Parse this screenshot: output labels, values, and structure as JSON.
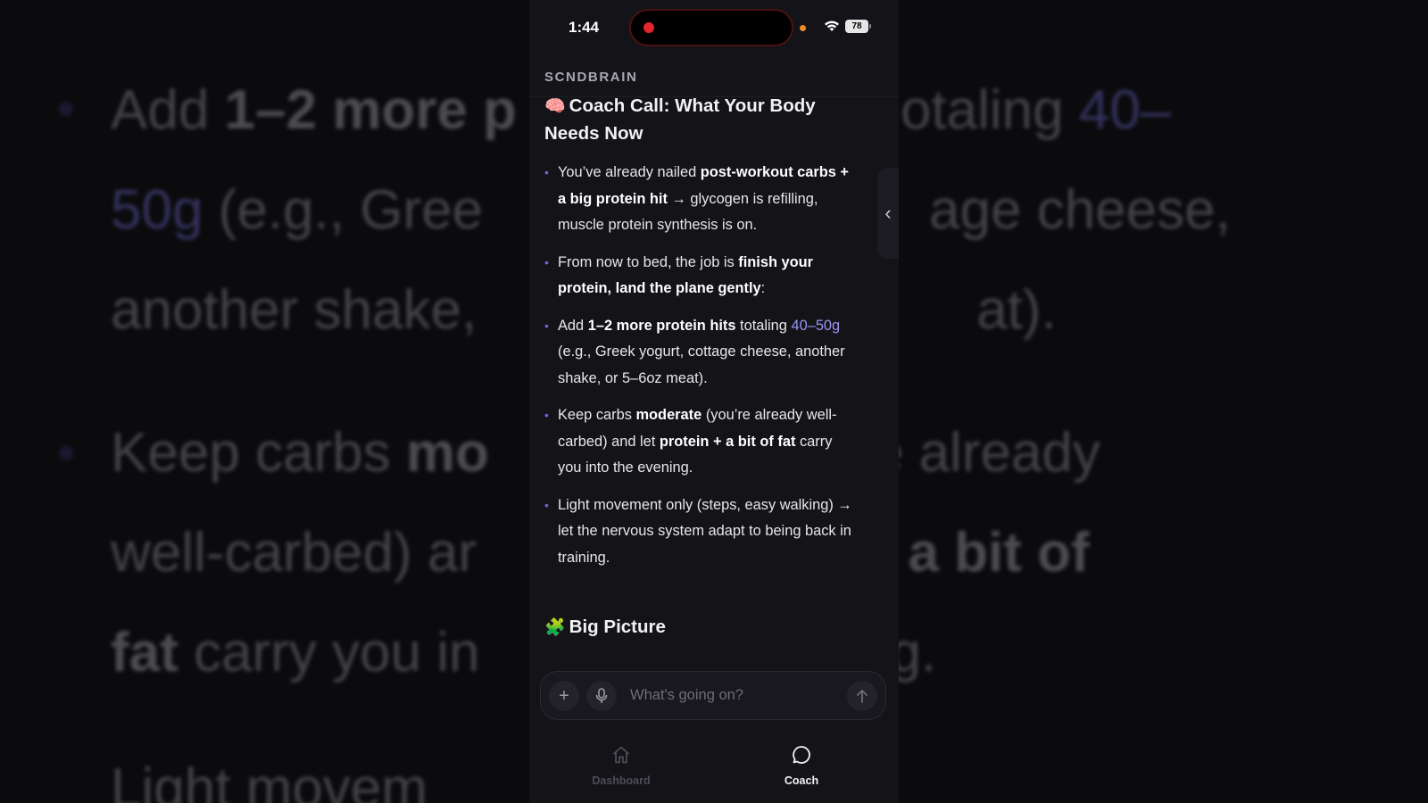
{
  "background_echo": {
    "lines": [
      {
        "a": "Add ",
        "b": "1–2 more ",
        "c": "",
        "d": "otaling ",
        "e": "40–"
      },
      {
        "a": "",
        "b": "",
        "c": "",
        "d": "",
        "e": ""
      }
    ]
  },
  "status": {
    "time": "1:44",
    "battery": "78"
  },
  "app": {
    "brand": "SCNDBRAIN"
  },
  "message": {
    "heading1": {
      "emoji": "🧠",
      "text": "Coach Call: What Your Body Needs Now"
    },
    "bullets": [
      {
        "t1": "You’ve already nailed ",
        "b1": "post-workout carbs + a big protein hit",
        "t2": " → glycogen is refilling, muscle protein synthesis is on."
      },
      {
        "t1": "From now to bed, the job is ",
        "b1": "finish your protein, land the plane gently",
        "t2": ":"
      },
      {
        "t1": "Add ",
        "b1": "1–2 more protein hits",
        "t2": " totaling ",
        "acc": "40–50g",
        "t3": " (e.g., Greek yogurt, cottage cheese, another shake, or 5–6oz meat)."
      },
      {
        "t1": "Keep carbs ",
        "b1": "moderate",
        "t2": " (you’re already well-carbed) and let ",
        "b2": "protein + a bit of fat",
        "t3": " carry you into the evening."
      },
      {
        "t1": "Light movement only (steps, easy walking) → let the nervous system adapt to being back in training."
      }
    ],
    "heading2": {
      "emoji": "🧩",
      "text": "Big Picture"
    }
  },
  "composer": {
    "placeholder": "What's going on?"
  },
  "tabs": [
    {
      "label": "Dashboard",
      "icon": "home-icon",
      "active": false
    },
    {
      "label": "Coach",
      "icon": "chat-bubble-icon",
      "active": true
    }
  ],
  "colors": {
    "accent": "#6a66d8",
    "highlight": "#9a94f2",
    "recording": "#e2262b"
  }
}
